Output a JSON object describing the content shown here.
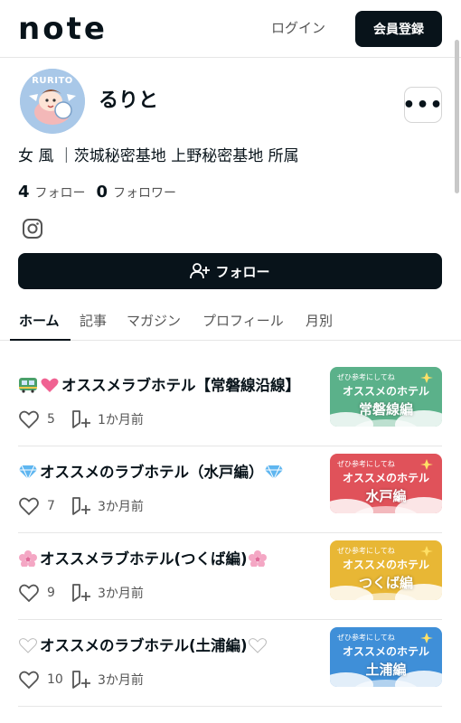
{
  "header": {
    "logo": "note",
    "login_label": "ログイン",
    "signup_label": "会員登録"
  },
  "profile": {
    "avatar_text": "RURITO",
    "name": "るりと",
    "bio": "女 風 ｜茨城秘密基地 上野秘密基地 所属",
    "follow_count": "4",
    "follow_label": "フォロー",
    "follower_count": "0",
    "follower_label": "フォロワー",
    "social_icon": "instagram-icon",
    "follow_button_label": "フォロー"
  },
  "tabs": [
    {
      "label": "ホーム",
      "active": true
    },
    {
      "label": "記事",
      "active": false
    },
    {
      "label": "マガジン",
      "active": false
    },
    {
      "label": "プロフィール",
      "active": false
    },
    {
      "label": "月別",
      "active": false
    }
  ],
  "articles": [
    {
      "title": "オススメラブホテル【常磐線沿線】",
      "likes": "5",
      "date": "1か月前",
      "thumb_header": "ぜひ参考にしてね",
      "thumb_title": "オススメのホテル",
      "thumb_sub": "常磐線編",
      "thumb_color": "#5bb18a"
    },
    {
      "title": "オススメのラブホテル（水戸編）",
      "likes": "7",
      "date": "3か月前",
      "thumb_header": "ぜひ参考にしてね",
      "thumb_title": "オススメのホテル",
      "thumb_sub": "水戸編",
      "thumb_color": "#e0525a"
    },
    {
      "title": "オススメラブホテル(つくば編)",
      "likes": "9",
      "date": "3か月前",
      "thumb_header": "ぜひ参考にしてね",
      "thumb_title": "オススメのホテル",
      "thumb_sub": "つくば編",
      "thumb_color": "#e8b735"
    },
    {
      "title": "オススメのラブホテル(土浦編)",
      "likes": "10",
      "date": "3か月前",
      "thumb_header": "ぜひ参考にしてね",
      "thumb_title": "オススメのホテル",
      "thumb_sub": "土浦編",
      "thumb_color": "#3f8fd8"
    }
  ]
}
